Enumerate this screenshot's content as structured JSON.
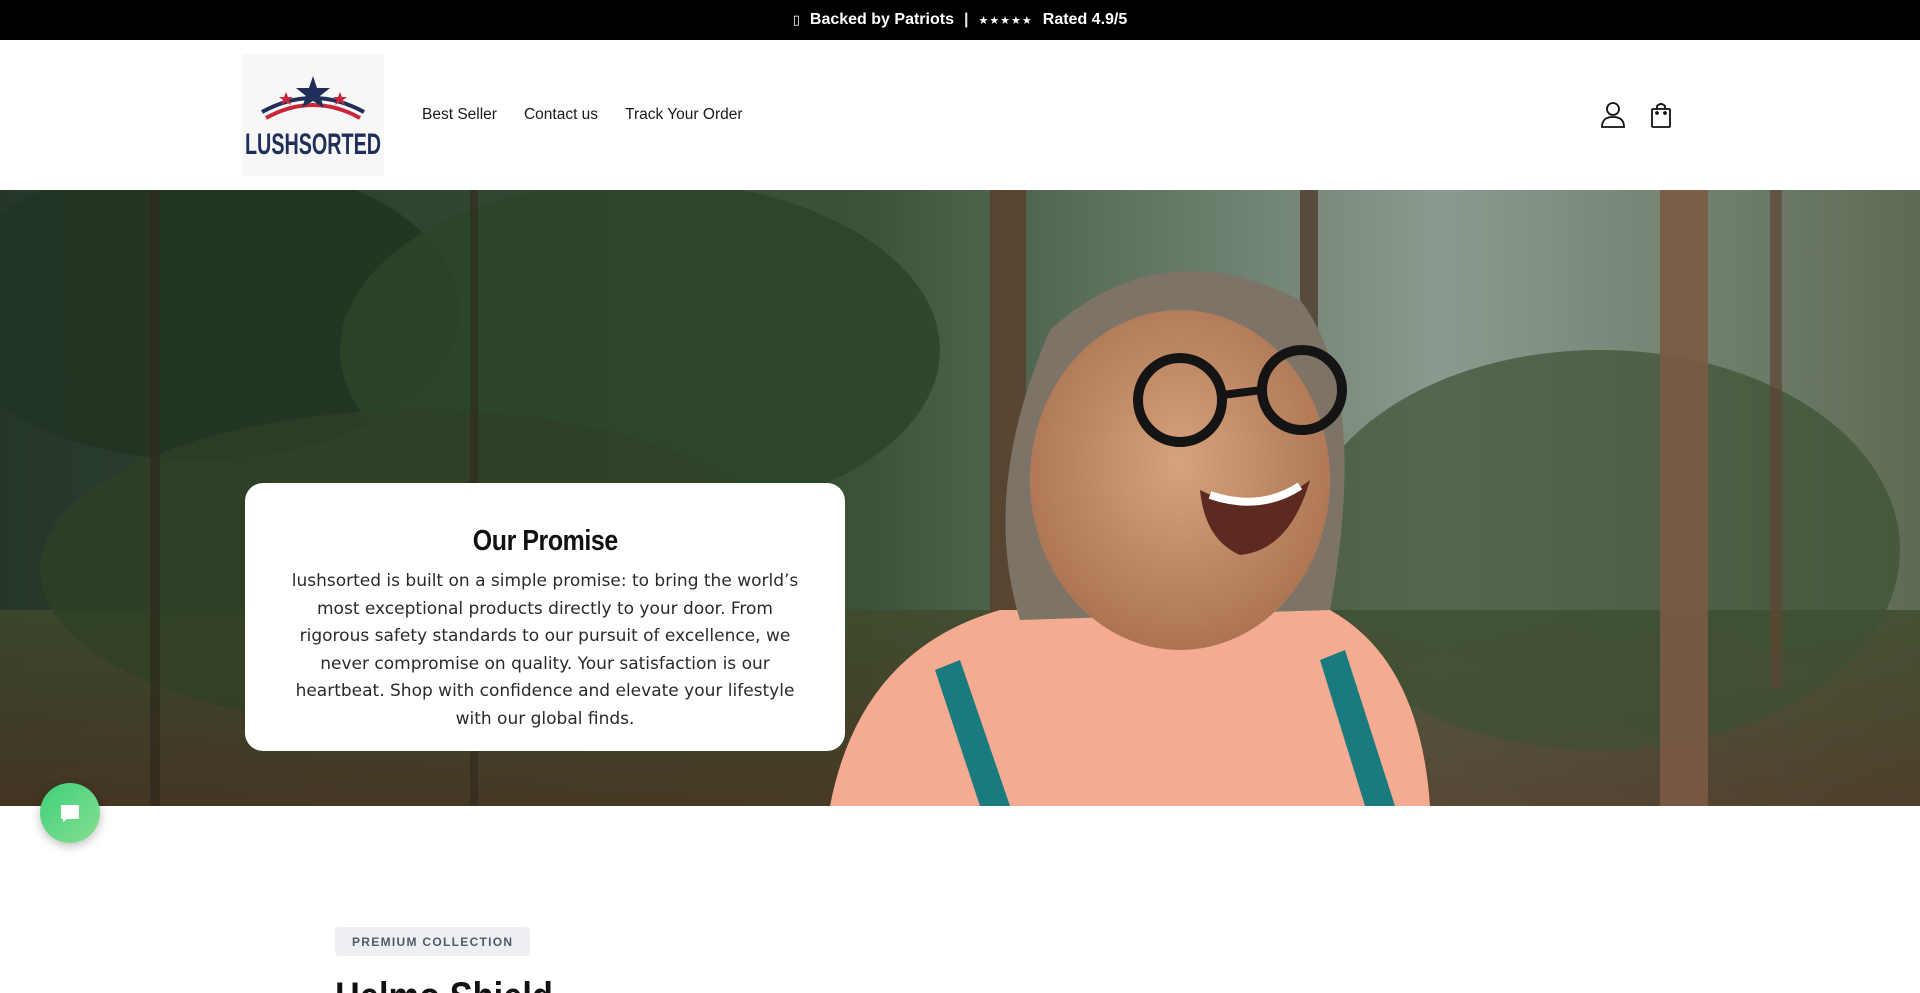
{
  "announcement": {
    "flag_icon": "flag-icon",
    "backed_text": "Backed by Patriots",
    "separator": "|",
    "stars": "★★★★★",
    "rating_text": "Rated 4.9/5"
  },
  "header": {
    "logo_text": "LUSHSORTED",
    "nav": [
      {
        "label": "Best Seller"
      },
      {
        "label": "Contact us"
      },
      {
        "label": "Track Your Order"
      }
    ],
    "icons": [
      "account-icon",
      "cart-icon"
    ]
  },
  "hero": {
    "card_title": "Our Promise",
    "card_body": "lushsorted is built on a simple promise: to bring the world’s most exceptional products directly to your door. From rigorous safety standards to our pursuit of excellence, we never compromise on quality. Your satisfaction is our heartbeat. Shop with confidence and elevate your lifestyle with our global finds."
  },
  "chat": {
    "icon": "chat-icon"
  },
  "section": {
    "badge": "PREMIUM COLLECTION",
    "title": "Helmo Shield"
  },
  "colors": {
    "announcement_bg": "#000000",
    "logo_navy": "#1f2f5a",
    "logo_red": "#c8283a",
    "chat_green": "#3fcf7a",
    "badge_bg": "#eeeff2"
  }
}
